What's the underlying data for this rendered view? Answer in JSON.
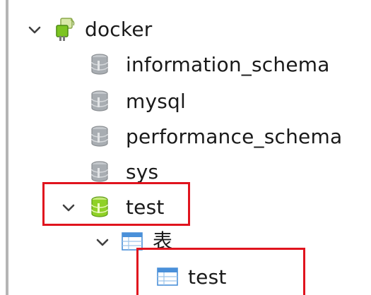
{
  "tree": {
    "connection": {
      "label": "docker",
      "icon": "connection-plug-icon",
      "expanded": true
    },
    "databases": [
      {
        "label": "information_schema",
        "icon": "database-gray-icon"
      },
      {
        "label": "mysql",
        "icon": "database-gray-icon"
      },
      {
        "label": "performance_schema",
        "icon": "database-gray-icon"
      },
      {
        "label": "sys",
        "icon": "database-gray-icon"
      },
      {
        "label": "test",
        "icon": "database-green-icon",
        "expanded": true
      }
    ],
    "tables_folder": {
      "label": "表",
      "icon": "tables-folder-icon",
      "expanded": true
    },
    "tables": [
      {
        "label": "test",
        "icon": "table-icon"
      }
    ]
  },
  "colors": {
    "highlight": "#e0141e",
    "db_gray": "#9aa0a6",
    "db_green": "#7cc421",
    "table_blue": "#4a90d9"
  }
}
